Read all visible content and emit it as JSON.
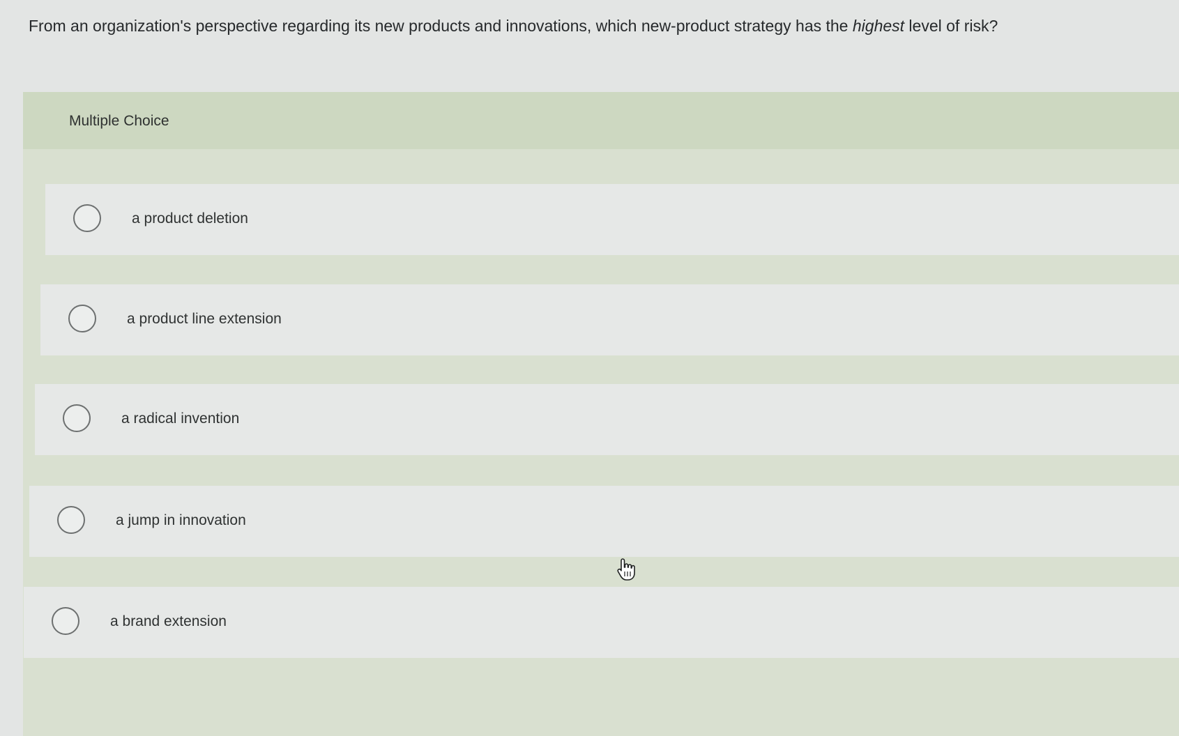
{
  "question": {
    "text_before": "From an organization's perspective regarding its new products and innovations, which new-product strategy has the ",
    "emphasis": "highest",
    "text_after": " level of risk?"
  },
  "multiple_choice": {
    "label": "Multiple Choice",
    "options": [
      {
        "label": "a product deletion",
        "selected": false
      },
      {
        "label": "a product line extension",
        "selected": false
      },
      {
        "label": "a radical invention",
        "selected": false
      },
      {
        "label": "a jump in innovation",
        "selected": false
      },
      {
        "label": "a brand extension",
        "selected": false
      }
    ]
  },
  "icons": {
    "cursor": "hand-pointer-icon",
    "radio": "radio-button-icon"
  },
  "colors": {
    "panel": "#d9e0d0",
    "header": "#cdd8c1",
    "option_background": "#e6e8e7",
    "page_background": "#e3e5e4"
  }
}
